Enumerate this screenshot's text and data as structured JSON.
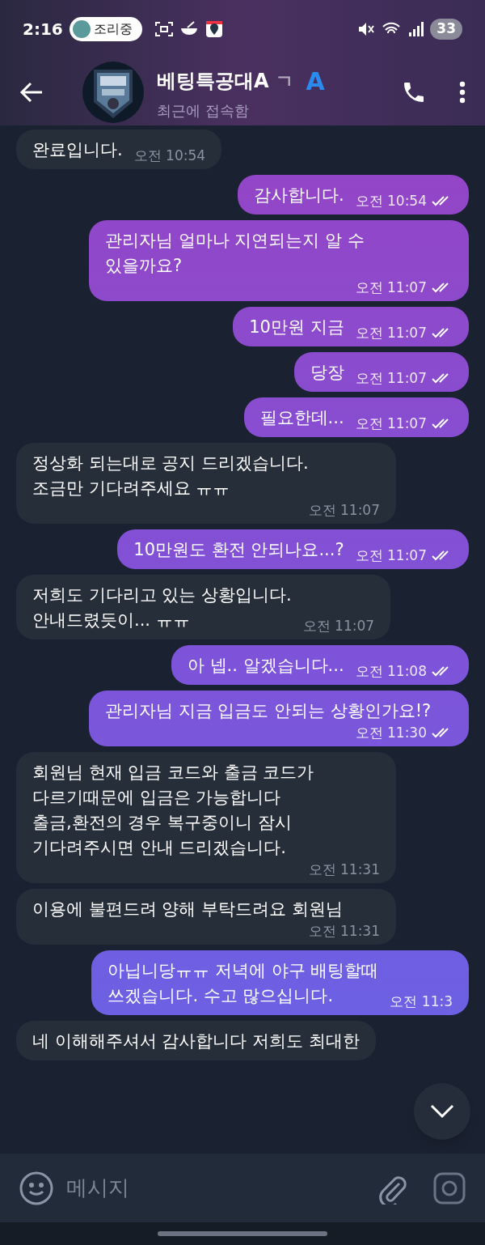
{
  "status_bar": {
    "time": "2:16",
    "activity": "조리중",
    "battery": "33"
  },
  "header": {
    "title": "베팅특공대A",
    "title_tail": "ㄱ",
    "badge": "A",
    "subtitle": "최근에 접속함"
  },
  "messages": [
    {
      "kind": "in",
      "text": "완료입니다.",
      "time": "오전 10:54"
    },
    {
      "kind": "out",
      "text": "감사합니다.",
      "time": "오전 10:54",
      "read": true
    },
    {
      "kind": "out",
      "text": "관리자님 얼마나 지연되는지 알 수\n있을까요?",
      "time": "오전 11:07",
      "read": true
    },
    {
      "kind": "out",
      "text": "10만원 지금",
      "time": "오전 11:07",
      "read": true
    },
    {
      "kind": "out",
      "text": "당장",
      "time": "오전 11:07",
      "read": true
    },
    {
      "kind": "out",
      "text": "필요한데...",
      "time": "오전 11:07",
      "read": true
    },
    {
      "kind": "in",
      "text": "정상화 되는대로 공지 드리겠습니다.\n조금만 기다려주세요 ㅠㅠ",
      "time": "오전 11:07"
    },
    {
      "kind": "out",
      "text": "10만원도 환전 안되나요...?",
      "time": "오전 11:07",
      "read": true
    },
    {
      "kind": "in",
      "text": "저희도 기다리고 있는 상황입니다.\n안내드렸듯이... ㅠㅠ",
      "time": "오전 11:07"
    },
    {
      "kind": "out",
      "text": "아 넵.. 알겠습니다...",
      "time": "오전 11:08",
      "read": true
    },
    {
      "kind": "out",
      "text": "관리자님 지금 입금도 안되는 상황인가요!?",
      "time": "오전 11:30",
      "read": true
    },
    {
      "kind": "in",
      "text": "회원님 현재 입금 코드와 출금 코드가\n다르기때문에 입금은 가능합니다\n출금,환전의 경우 복구중이니 잠시\n기다려주시면 안내 드리겠습니다.",
      "time": "오전 11:31"
    },
    {
      "kind": "in",
      "text": "이용에 불편드려 양해 부탁드려요 회원님",
      "time": "오전 11:31"
    },
    {
      "kind": "out",
      "text": "아닙니당ㅠㅠ 저녁에 야구 배팅할때\n쓰겠습니다. 수고 많으십니다.",
      "time": "오전 11:3"
    },
    {
      "kind": "in",
      "text": "네 이해해주셔서 감사합니다 저희도 최대한"
    }
  ],
  "composer": {
    "placeholder": "메시지"
  }
}
